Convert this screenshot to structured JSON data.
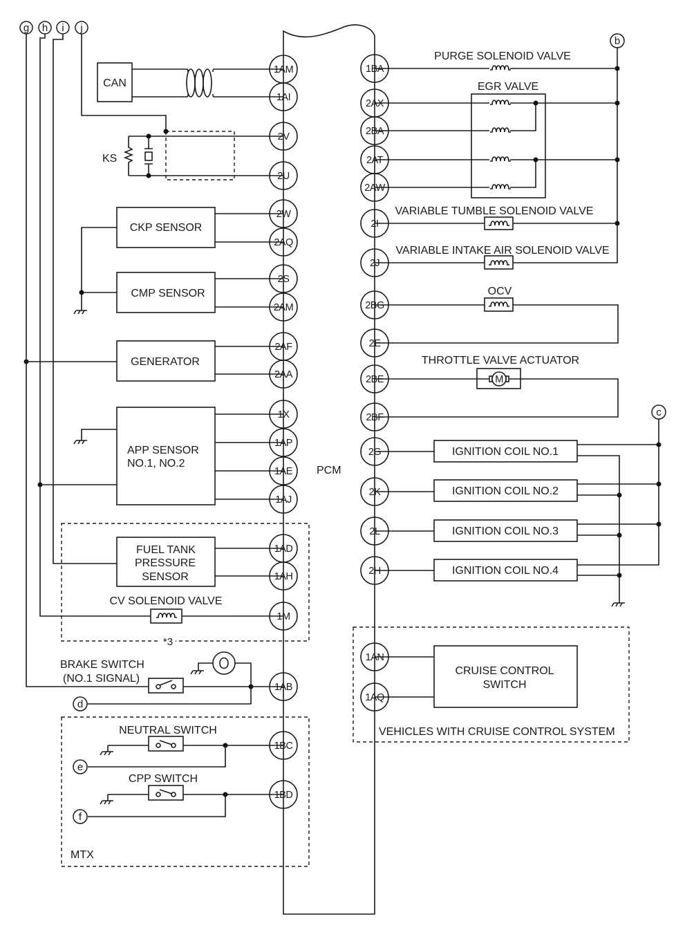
{
  "module": {
    "label": "PCM"
  },
  "ref_tags": {
    "g": "g",
    "h": "h",
    "i": "i",
    "j": "j",
    "b": "b",
    "c": "c",
    "d": "d",
    "e": "e",
    "f": "f"
  },
  "left_components": {
    "can": {
      "label": "CAN",
      "pins": [
        "1AM",
        "1AI"
      ]
    },
    "ks": {
      "label": "KS",
      "pins": [
        "2V",
        "2U"
      ]
    },
    "ckp": {
      "label": "CKP SENSOR",
      "pins": [
        "2W",
        "2AQ"
      ]
    },
    "cmp": {
      "label": "CMP SENSOR",
      "pins": [
        "2S",
        "2AM"
      ]
    },
    "generator": {
      "label": "GENERATOR",
      "pins": [
        "2AF",
        "2AA"
      ]
    },
    "app": {
      "label_line1": "APP SENSOR",
      "label_line2": "NO.1, NO.2",
      "pins": [
        "1X",
        "1AP",
        "1AE",
        "1AJ"
      ]
    },
    "fuel_tank": {
      "label_line1": "FUEL TANK",
      "label_line2": "PRESSURE",
      "label_line3": "SENSOR",
      "pins": [
        "1AD",
        "1AH"
      ]
    },
    "cv_solenoid": {
      "label": "CV SOLENOID VALVE",
      "pin": "1M"
    },
    "group3_note": "*3",
    "brake_switch": {
      "label_line1": "BRAKE  SWITCH",
      "label_line2": "(NO.1 SIGNAL)",
      "pin": "1AB"
    },
    "neutral_switch": {
      "label": "NEUTRAL  SWITCH",
      "pin": "1BC"
    },
    "cpp_switch": {
      "label": "CPP  SWITCH",
      "pin": "1BD"
    },
    "mtx_group": "MTX"
  },
  "right_components": {
    "purge": {
      "label": "PURGE SOLENOID VALVE",
      "pin": "1BA"
    },
    "egr": {
      "label": "EGR VALVE",
      "pins": [
        "2AX",
        "2BA",
        "2AT",
        "2AW"
      ]
    },
    "tumble": {
      "label": "VARIABLE TUMBLE SOLENOID VALVE",
      "pin": "2I"
    },
    "intake": {
      "label": "VARIABLE INTAKE AIR SOLENOID VALVE",
      "pin": "2J"
    },
    "ocv": {
      "label": "OCV",
      "pins": [
        "2BG",
        "2E"
      ]
    },
    "throttle": {
      "label": "THROTTLE VALVE ACTUATOR",
      "motor": "M",
      "pins": [
        "2BE",
        "2BF"
      ]
    },
    "ignition_coils": [
      {
        "label": "IGNITION COIL NO.1",
        "pin": "2G"
      },
      {
        "label": "IGNITION COIL NO.2",
        "pin": "2K"
      },
      {
        "label": "IGNITION COIL NO.3",
        "pin": "2L"
      },
      {
        "label": "IGNITION COIL NO.4",
        "pin": "2H"
      }
    ],
    "cruise": {
      "label_line1": "CRUISE CONTROL",
      "label_line2": "SWITCH",
      "pins": [
        "1AN",
        "1AQ"
      ],
      "group": "VEHICLES WITH CRUISE CONTROL SYSTEM"
    }
  }
}
